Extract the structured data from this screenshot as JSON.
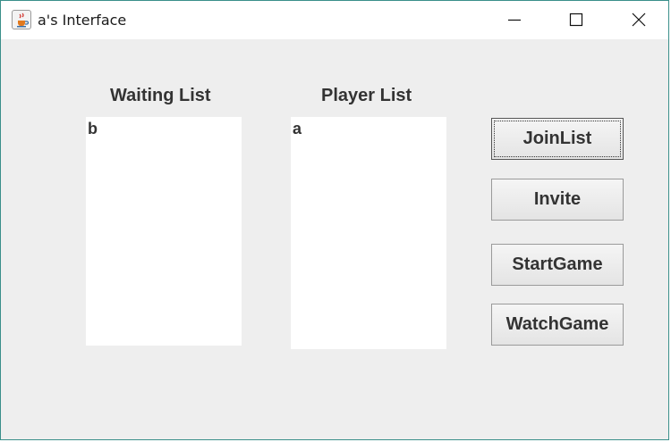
{
  "window": {
    "title": "a's Interface",
    "icon": "java-coffee-icon"
  },
  "title_controls": [
    "minimize-icon",
    "maximize-icon",
    "close-icon"
  ],
  "waiting_list": {
    "label": "Waiting List",
    "items": [
      "b"
    ]
  },
  "player_list": {
    "label": "Player List",
    "items": [
      "a"
    ]
  },
  "buttons": {
    "join": "JoinList",
    "invite": "Invite",
    "start": "StartGame",
    "watch": "WatchGame"
  },
  "colors": {
    "background": "#eeeeee",
    "titlebar": "#ffffff",
    "list_bg": "#ffffff",
    "text": "#333333"
  }
}
